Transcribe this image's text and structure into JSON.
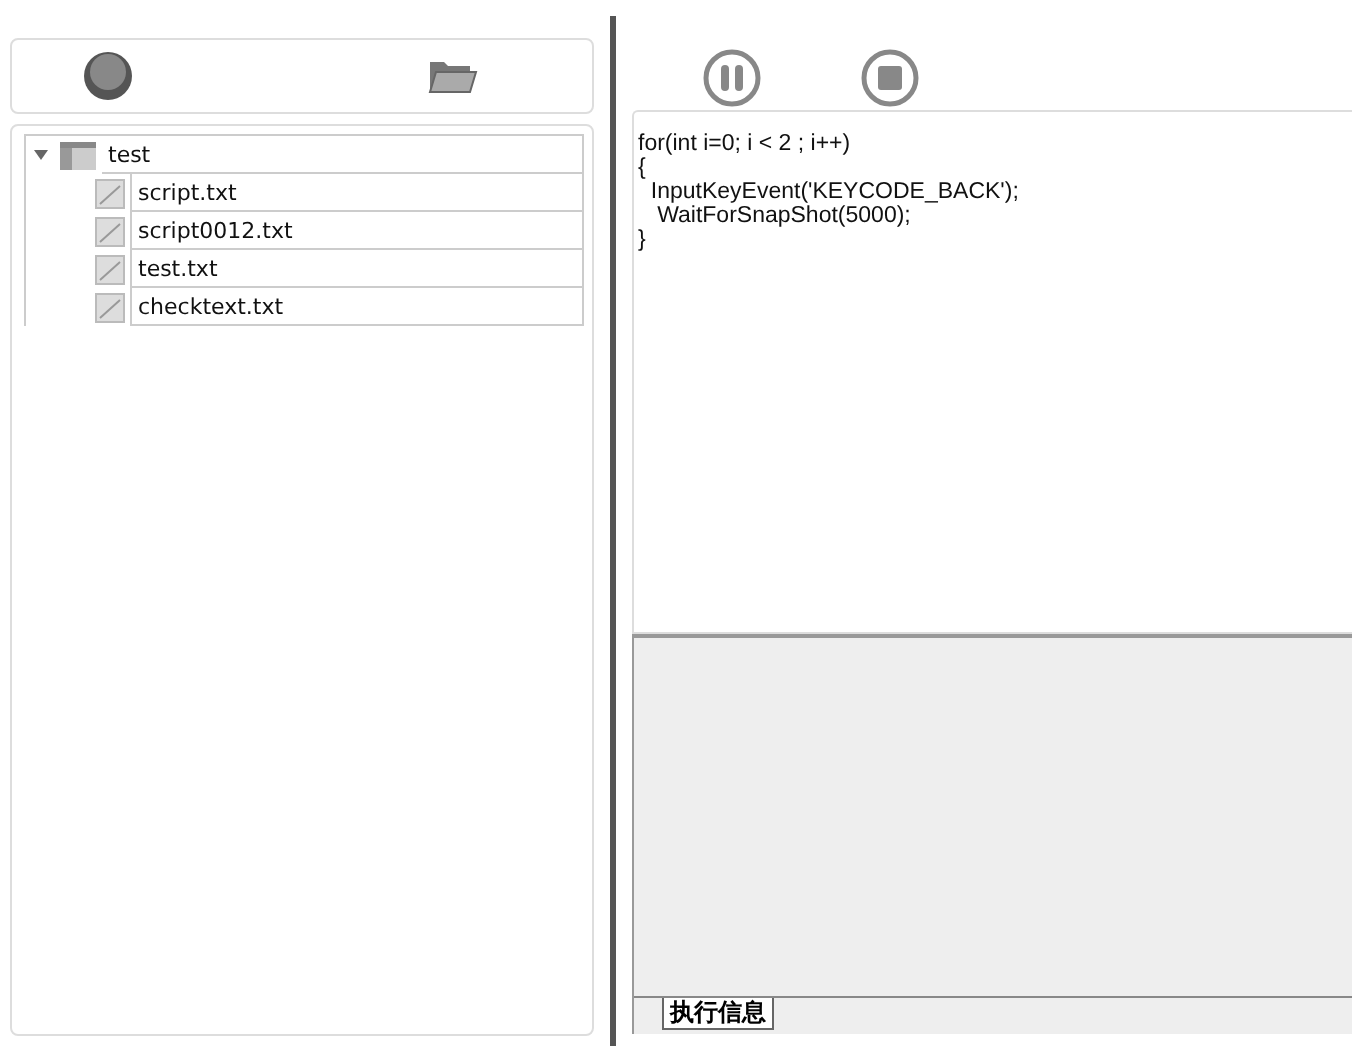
{
  "file_tree": [
    {
      "label": "test",
      "expanded": true,
      "children": [
        {
          "label": "script.txt"
        },
        {
          "label": "script0012.txt"
        },
        {
          "label": "test.txt"
        },
        {
          "label": "checktext.txt"
        }
      ]
    }
  ],
  "editor": {
    "code": "for(int i=0; i < 2 ; i++)\n{\n  InputKeyEvent('KEYCODE_BACK');\n   WaitForSnapShot(5000);\n}"
  },
  "output_panel": {
    "tabs": [
      {
        "label": "执行信息",
        "selected": true
      }
    ]
  }
}
